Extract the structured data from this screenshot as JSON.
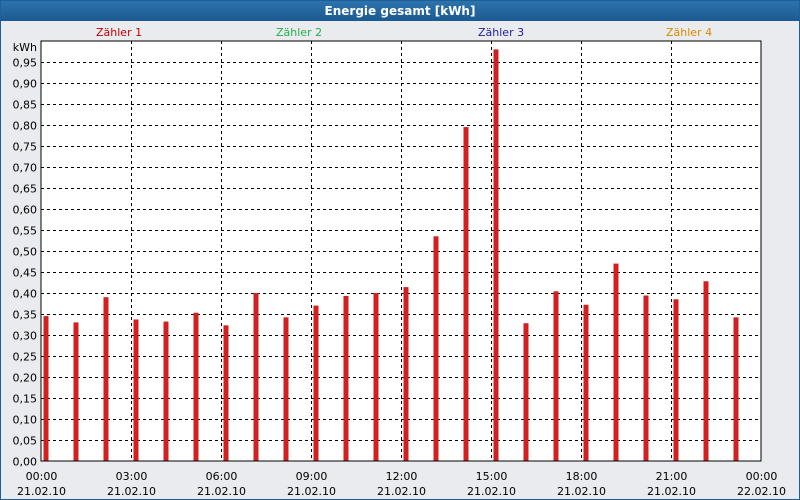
{
  "window": {
    "title": "Energie gesamt [kWh]"
  },
  "legend": [
    {
      "label": "Zähler 1",
      "color": "#c00000"
    },
    {
      "label": "Zähler 2",
      "color": "#22b14c"
    },
    {
      "label": "Zähler 3",
      "color": "#1f1f9a"
    },
    {
      "label": "Zähler 4",
      "color": "#d68a00"
    }
  ],
  "colors": {
    "bar": "#d21f1f",
    "plot_background": "#ffffff",
    "frame_background": "#e9ebee",
    "titlebar": "#1e5f96"
  },
  "chart_data": {
    "type": "bar",
    "title": "Energie gesamt [kWh]",
    "ylabel": "kWh",
    "xlabel": "",
    "ylim": [
      0,
      1.0
    ],
    "yticks": [
      "0,00",
      "0,05",
      "0,10",
      "0,15",
      "0,20",
      "0,25",
      "0,30",
      "0,35",
      "0,40",
      "0,45",
      "0,50",
      "0,55",
      "0,60",
      "0,65",
      "0,70",
      "0,75",
      "0,80",
      "0,85",
      "0,90",
      "0,95"
    ],
    "xticks": [
      {
        "time": "00:00",
        "date": "21.02.10"
      },
      {
        "time": "03:00",
        "date": "21.02.10"
      },
      {
        "time": "06:00",
        "date": "21.02.10"
      },
      {
        "time": "09:00",
        "date": "21.02.10"
      },
      {
        "time": "12:00",
        "date": "21.02.10"
      },
      {
        "time": "15:00",
        "date": "21.02.10"
      },
      {
        "time": "18:00",
        "date": "21.02.10"
      },
      {
        "time": "21:00",
        "date": "21.02.10"
      },
      {
        "time": "00:00",
        "date": "22.02.10"
      }
    ],
    "grid": true,
    "legend_position": "top",
    "categories": [
      "00:00",
      "01:00",
      "02:00",
      "03:00",
      "04:00",
      "05:00",
      "06:00",
      "07:00",
      "08:00",
      "09:00",
      "10:00",
      "11:00",
      "12:00",
      "13:00",
      "14:00",
      "15:00",
      "16:00",
      "17:00",
      "18:00",
      "19:00",
      "20:00",
      "21:00",
      "22:00",
      "23:00"
    ],
    "series": [
      {
        "name": "Zähler 1",
        "values": [
          0.345,
          0.33,
          0.39,
          0.337,
          0.332,
          0.353,
          0.323,
          0.4,
          0.342,
          0.37,
          0.393,
          0.4,
          0.414,
          0.535,
          0.795,
          0.98,
          0.328,
          0.404,
          0.372,
          0.47,
          0.394,
          0.385,
          0.428,
          0.342
        ]
      }
    ]
  }
}
